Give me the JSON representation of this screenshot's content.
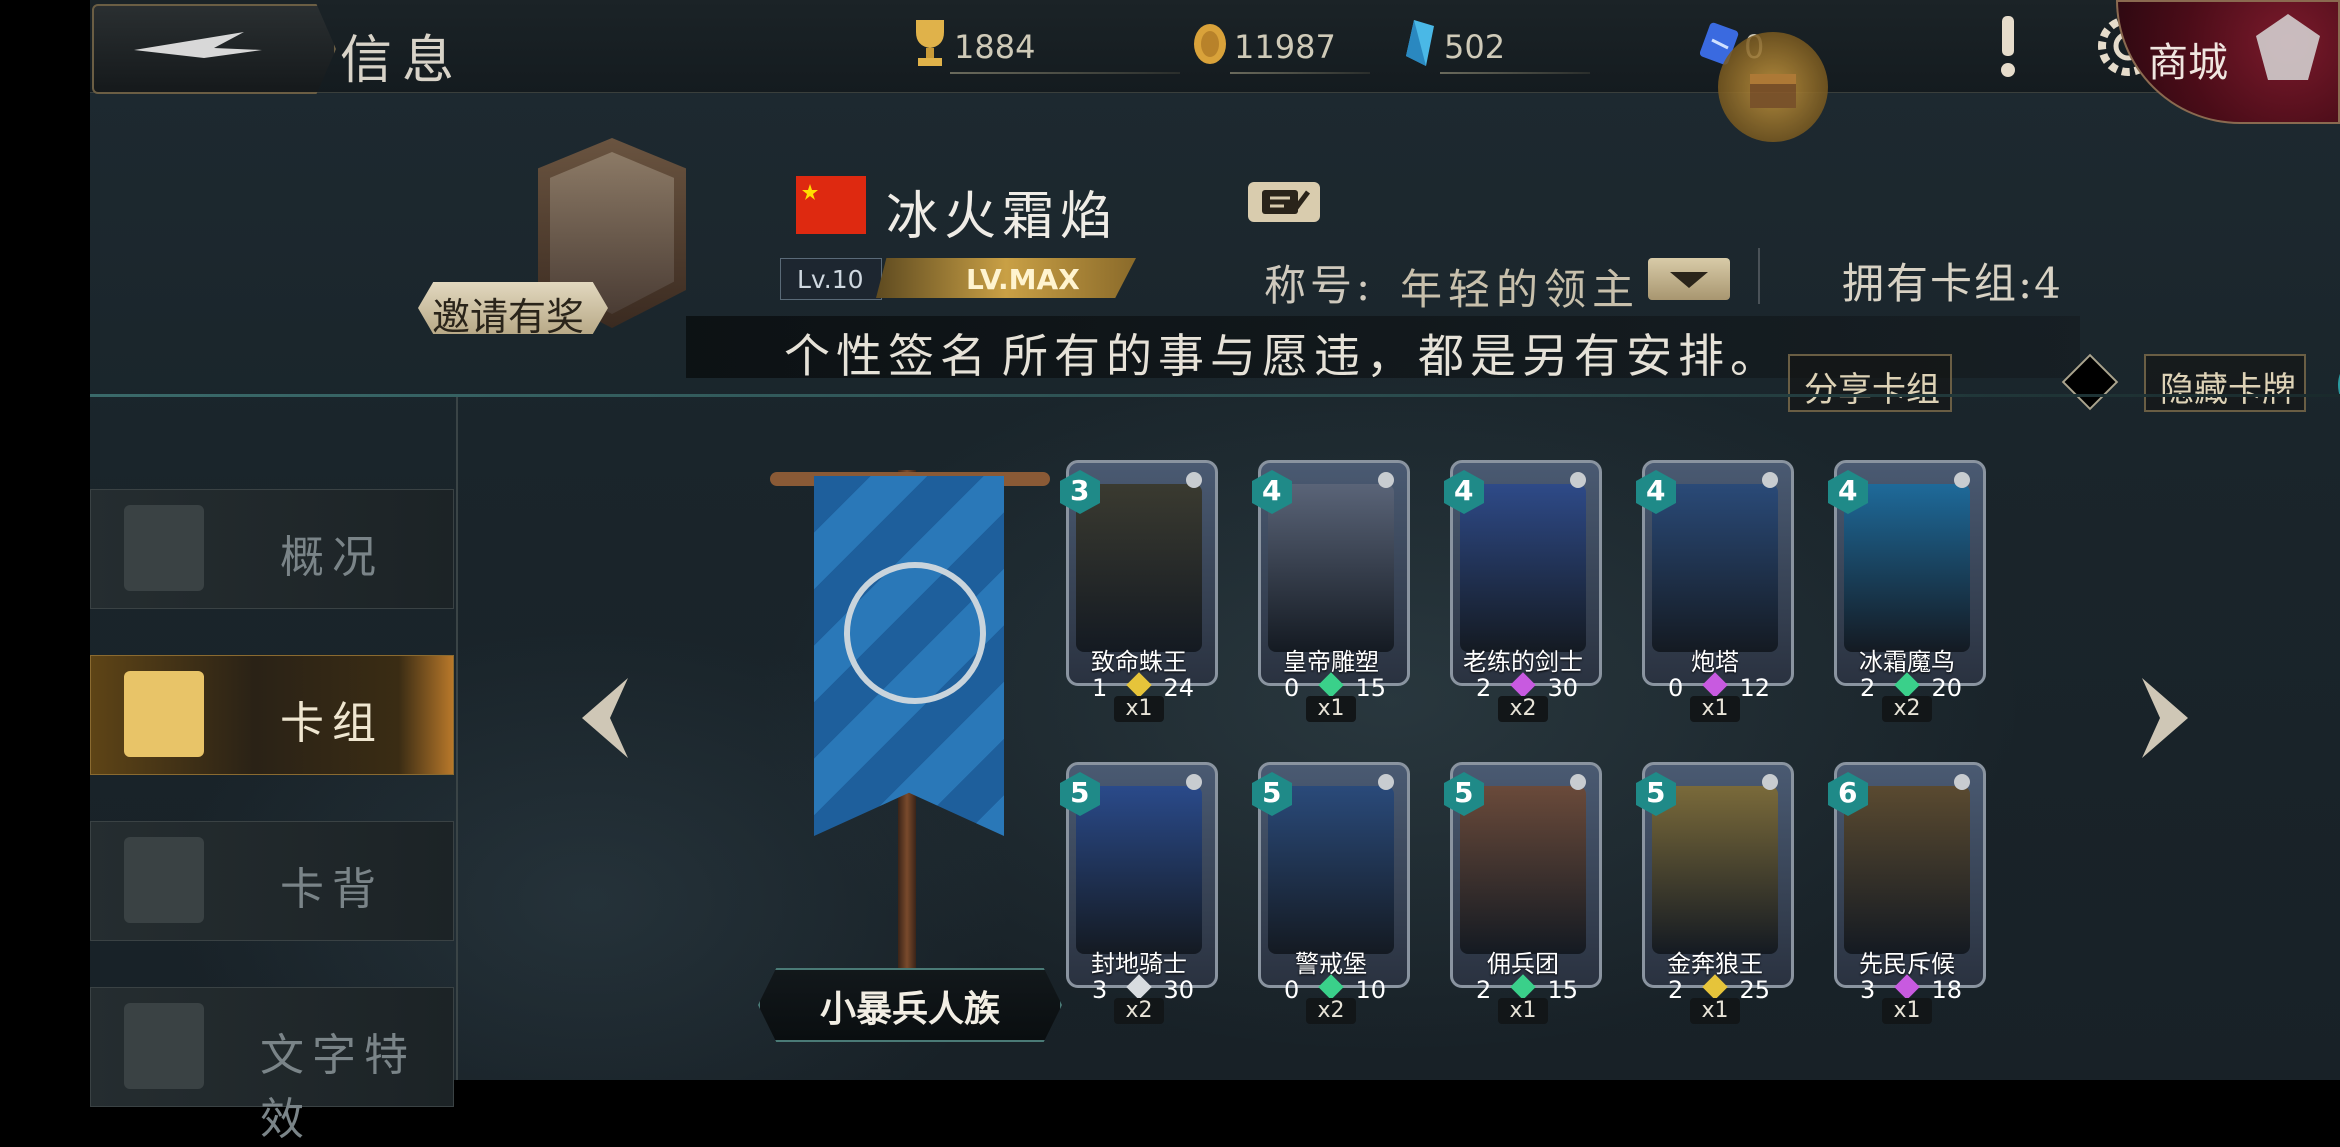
{
  "header": {
    "title": "信息",
    "resources": [
      {
        "name": "trophy",
        "value": "1884",
        "icon": "trophy-icon",
        "color": "#e0b24a"
      },
      {
        "name": "gold",
        "value": "11987",
        "icon": "coin-icon",
        "color": "#d9a23a"
      },
      {
        "name": "crystal",
        "value": "502",
        "icon": "crystal-icon",
        "color": "#4ab8e6"
      },
      {
        "name": "ticket",
        "value": "0",
        "icon": "ticket-icon",
        "color": "#3a6ae0"
      }
    ],
    "shop_label": "商城"
  },
  "profile": {
    "name": "冰火霜焰",
    "flag": "china-flag-icon",
    "level": "Lv.10",
    "level_status": "LV.MAX",
    "invite_label": "邀请有奖",
    "title_label": "称号:",
    "title_value": "年轻的领主",
    "decks_owned": "拥有卡组:4",
    "signature_label": "个性签名",
    "signature_text": "所有的事与愿违，都是另有安排。"
  },
  "actions": {
    "share_deck": "分享卡组",
    "hide_cards": "隐藏卡牌",
    "help": "?"
  },
  "sidebar": {
    "tabs": [
      {
        "label": "概况",
        "icon": "document-icon",
        "active": false
      },
      {
        "label": "卡组",
        "icon": "cards-icon",
        "active": true
      },
      {
        "label": "卡背",
        "icon": "card-back-icon",
        "active": false
      },
      {
        "label": "文字特效",
        "icon": "text-effect-icon",
        "active": false
      }
    ]
  },
  "deck": {
    "name": "小暴兵人族",
    "banner_color": "#1e5f9c"
  },
  "cards": [
    {
      "name": "致命蛛王",
      "cost": "3",
      "atk": "1",
      "hp": "24",
      "qty": "x1",
      "gem": "#e6c43a",
      "art": "#3a3a30"
    },
    {
      "name": "皇帝雕塑",
      "cost": "4",
      "atk": "0",
      "hp": "15",
      "qty": "x1",
      "gem": "#3ad08a",
      "art": "#5a6478"
    },
    {
      "name": "老练的剑士",
      "cost": "4",
      "atk": "2",
      "hp": "30",
      "qty": "x2",
      "gem": "#c85ae0",
      "art": "#2e4a88"
    },
    {
      "name": "炮塔",
      "cost": "4",
      "atk": "0",
      "hp": "12",
      "qty": "x1",
      "gem": "#c85ae0",
      "art": "#2a4a78"
    },
    {
      "name": "冰霜魔鸟",
      "cost": "4",
      "atk": "2",
      "hp": "20",
      "qty": "x2",
      "gem": "#3ad08a",
      "art": "#1e6a9a"
    },
    {
      "name": "封地骑士",
      "cost": "5",
      "atk": "3",
      "hp": "30",
      "qty": "x2",
      "gem": "#d8dce0",
      "art": "#2a4a8a"
    },
    {
      "name": "警戒堡",
      "cost": "5",
      "atk": "0",
      "hp": "10",
      "qty": "x2",
      "gem": "#3ad08a",
      "art": "#2a4a7a"
    },
    {
      "name": "佣兵团",
      "cost": "5",
      "atk": "2",
      "hp": "15",
      "qty": "x1",
      "gem": "#3ad08a",
      "art": "#6a4a3a"
    },
    {
      "name": "金奔狼王",
      "cost": "5",
      "atk": "2",
      "hp": "25",
      "qty": "x1",
      "gem": "#e6c43a",
      "art": "#7a6a3a"
    },
    {
      "name": "先民斥候",
      "cost": "6",
      "atk": "3",
      "hp": "18",
      "qty": "x1",
      "gem": "#c85ae0",
      "art": "#5a4a30"
    }
  ]
}
